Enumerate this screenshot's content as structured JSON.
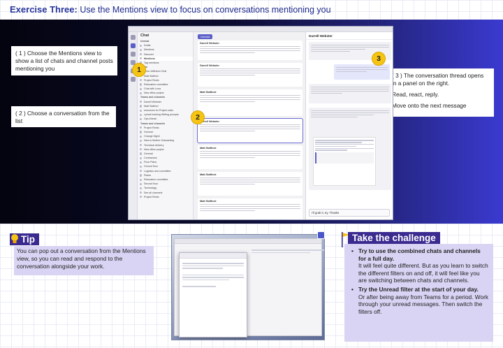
{
  "header": {
    "title_bold": "Exercise Three:",
    "title_rest": "Use the Mentions view to focus on conversations mentioning you"
  },
  "callouts": {
    "one": "( 1 ) Choose the Mentions view to show a list of chats and channel posts mentioning you",
    "two": "( 2 ) Choose a conversation from the list",
    "three_a": "( 3 ) The conversation thread opens in a panel on the right.",
    "three_b": "Read, react, reply.",
    "three_c": "Move onto the next message"
  },
  "badges": [
    "1",
    "2",
    "3"
  ],
  "teams": {
    "panel_title": "Chat",
    "tab": "Unread",
    "chat_rows": [
      {
        "label": "Unread",
        "type": "section"
      },
      {
        "label": "Drafts",
        "type": "row"
      },
      {
        "label": "Mentions",
        "type": "row"
      },
      {
        "label": "Discover",
        "type": "row"
      },
      {
        "label": "Mentions",
        "type": "sel"
      },
      {
        "label": "Tag mentions",
        "type": "row"
      },
      {
        "label": "Chats",
        "type": "section"
      },
      {
        "label": "Lena Jaffersen Chat",
        "type": "row"
      },
      {
        "label": "Matt Stafford",
        "type": "row"
      },
      {
        "label": "Project Redlo",
        "type": "row"
      },
      {
        "label": "Relocation committee",
        "type": "row"
      },
      {
        "label": "Chat with Lena",
        "type": "row"
      },
      {
        "label": "New office project",
        "type": "row"
      },
      {
        "label": "Teams and channels",
        "type": "section"
      },
      {
        "label": "Darrell Webster",
        "type": "row"
      },
      {
        "label": "Matt Stafford",
        "type": "row"
      },
      {
        "label": "resources for Project radio",
        "type": "row"
      },
      {
        "label": "Lyrical tracking Writing prompts",
        "type": "row"
      },
      {
        "label": "Ops Ahead",
        "type": "row"
      },
      {
        "label": "Teams and channels",
        "type": "section"
      },
      {
        "label": "Project Redlo",
        "type": "row"
      },
      {
        "label": "General",
        "type": "row"
      },
      {
        "label": "Change Mgmt",
        "type": "row"
      },
      {
        "label": "New to Mother Onboarding",
        "type": "row"
      },
      {
        "label": "Technical delivery",
        "type": "row"
      },
      {
        "label": "New office project",
        "type": "row"
      },
      {
        "label": "General",
        "type": "row"
      },
      {
        "label": "Contractors",
        "type": "row"
      },
      {
        "label": "Floor Plans",
        "type": "row"
      },
      {
        "label": "Ground floor",
        "type": "row"
      },
      {
        "label": "Logistics and committee",
        "type": "row"
      },
      {
        "label": "Plants",
        "type": "row"
      },
      {
        "label": "Relocation committee",
        "type": "row"
      },
      {
        "label": "Second floor",
        "type": "row"
      },
      {
        "label": "Technology",
        "type": "row"
      },
      {
        "label": "See all channels",
        "type": "row"
      },
      {
        "label": "Project Redlo",
        "type": "row"
      }
    ],
    "posts": [
      {
        "who": "Darrell Webster"
      },
      {
        "who": "Darrell Webster"
      },
      {
        "who": "Matt Stafford"
      },
      {
        "who": "Darrell Webster"
      },
      {
        "who": "Matt Stafford"
      },
      {
        "who": "Matt Stafford"
      },
      {
        "who": "Matt Stafford"
      }
    ],
    "thread_title": "Darrell Webster",
    "compose_text": "I'll grab it, try. Thanks"
  },
  "tip": {
    "title": "Tip",
    "text": "You can pop out a conversation from the Mentions view, so you can read and respond to the conversation alongside your work."
  },
  "challenge": {
    "title": "Take the challenge",
    "items": [
      {
        "bold": "Try to use the combined chats and channels for a full day.",
        "rest": "It will feel quite different. But as you learn to switch the different filters on and off, it will feel like you are switching between chats and channels."
      },
      {
        "bold": "Try the Unread filter at the start of your day.",
        "rest": "Or after being away from Teams for a period. Work through your unread messages. Then switch the filters off."
      }
    ]
  },
  "colors": {
    "accent": "#3b2a8f",
    "badge": "#f6c414",
    "box": "#d9d4f4",
    "title": "#1f2b8c"
  }
}
